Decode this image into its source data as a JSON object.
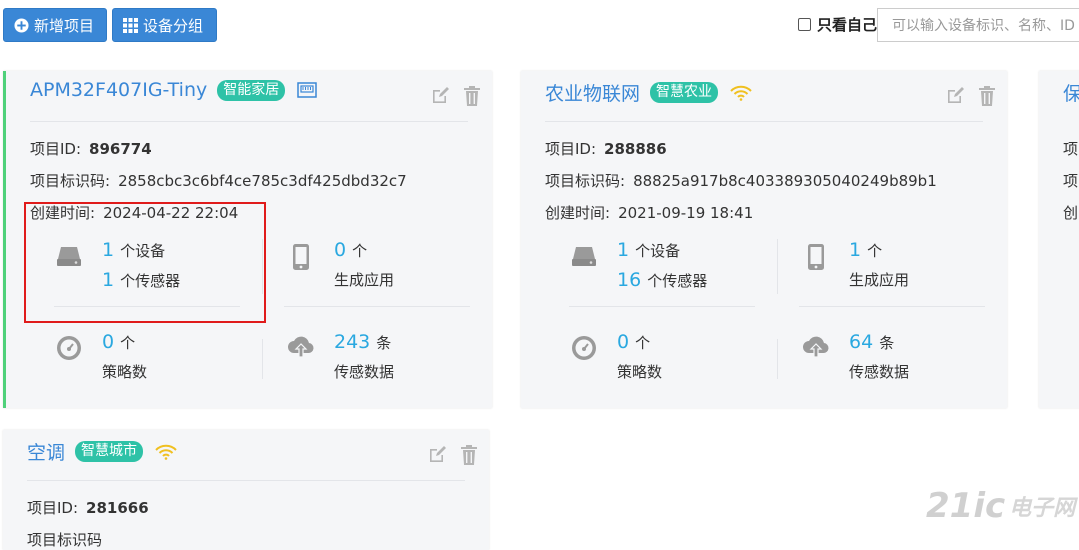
{
  "toolbar": {
    "add_project_label": "新增项目",
    "device_group_label": "设备分组",
    "only_mine_label": "只看自己",
    "search_placeholder": "可以输入设备标识、名称、ID"
  },
  "labels": {
    "project_id": "项目ID:",
    "project_key": "项目标识码:",
    "created_at": "创建时间:",
    "policies": "策略数",
    "sensor_data": "传感数据",
    "generated_apps": "生成应用",
    "unit_ge": "个",
    "unit_tiao": "条",
    "device_suffix": "个设备",
    "sensor_suffix": "个传感器"
  },
  "cards": [
    {
      "title": "APM32F407IG-Tiny",
      "tag": "智能家居",
      "type_icon": "ethernet-icon",
      "project_id": "896774",
      "project_key": "2858cbc3c6bf4ce785c3df425dbd32c7",
      "created_at": "2024-04-22 22:04",
      "devices": "1",
      "sensors": "1",
      "apps": "0",
      "policies": "0",
      "data_count": "243"
    },
    {
      "title": "农业物联网",
      "tag": "智慧农业",
      "type_icon": "wifi-icon",
      "project_id": "288886",
      "project_key": "88825a917b8c403389305040249b89b1",
      "created_at": "2021-09-19 18:41",
      "devices": "1",
      "sensors": "16",
      "apps": "1",
      "policies": "0",
      "data_count": "64"
    },
    {
      "title": "保",
      "label_id": "项",
      "label_key": "项",
      "label_created": "创"
    },
    {
      "title": "空调",
      "tag": "智慧城市",
      "type_icon": "wifi-icon",
      "project_id": "281666",
      "project_key_partial": "项目标识码"
    }
  ],
  "watermark": {
    "brand": "21ic",
    "cn": "电子网"
  },
  "colors": {
    "accent": "#3a87d6",
    "tag": "#2ec2a7",
    "number": "#2aa8e0",
    "active_border": "#4fd17a",
    "highlight": "#e01b1b"
  }
}
